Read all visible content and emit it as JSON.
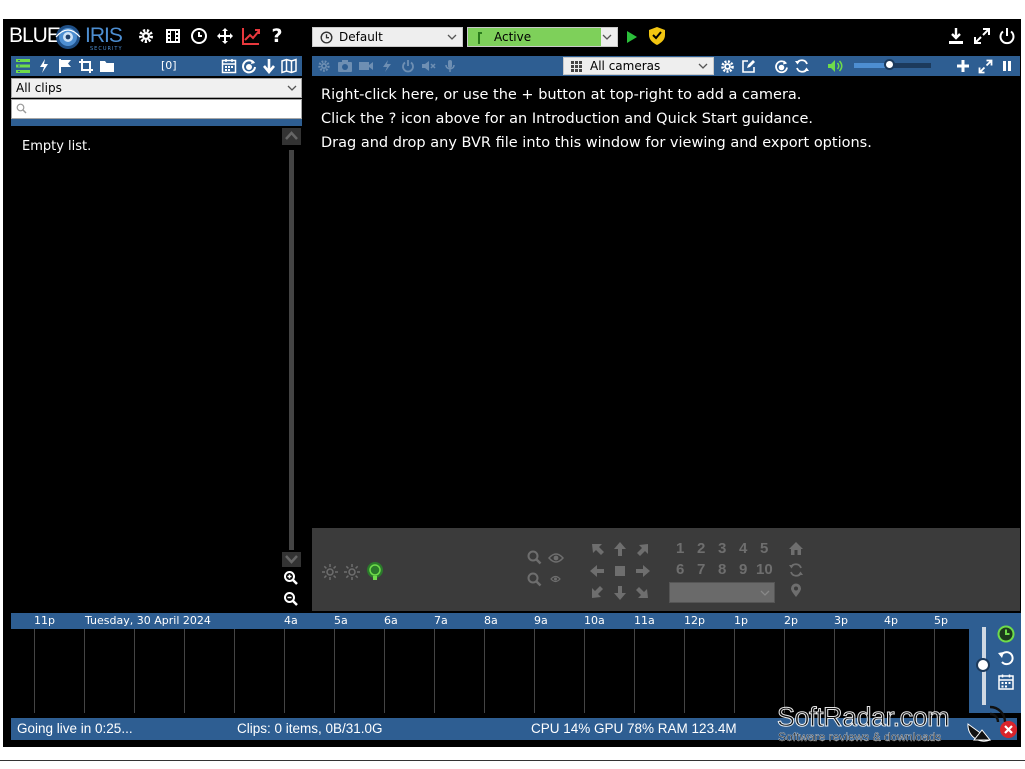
{
  "app": {
    "logo_left": "BLUE",
    "logo_right": "IRIS",
    "logo_sub": "SECURITY"
  },
  "toolbar": {
    "profile_value": "Default",
    "schedule_value": "Active",
    "icons": [
      "gear-icon",
      "clapboard-icon",
      "clock-icon",
      "move-icon",
      "chart-icon",
      "help-icon",
      "play-icon",
      "shield-icon",
      "download-icon",
      "fullscreen-icon",
      "power-icon"
    ]
  },
  "clips": {
    "count_badge": "[0]",
    "filter_value": "All clips",
    "search_placeholder": "",
    "empty_text": "Empty list."
  },
  "cameras": {
    "group_value": "All cameras",
    "volume_level": 0.45,
    "messages": [
      "Right-click here, or use the + button at top-right to add a camera.",
      "Click the ? icon above for an Introduction and Quick Start guidance.",
      "Drag and drop any BVR file into this window for viewing and export options."
    ]
  },
  "ptz": {
    "presets_row1": [
      "1",
      "2",
      "3",
      "4",
      "5"
    ],
    "presets_row2": [
      "6",
      "7",
      "8",
      "9",
      "10"
    ],
    "preset_select_value": ""
  },
  "timeline": {
    "date_label": "Tuesday, 30 April 2024",
    "hours": [
      "11p",
      "4a",
      "5a",
      "6a",
      "7a",
      "8a",
      "9a",
      "10a",
      "11a",
      "12p",
      "1p",
      "2p",
      "3p",
      "4p",
      "5p"
    ]
  },
  "status": {
    "live_text": "Going live in 0:25...",
    "clips_text": "Clips: 0 items, 0B/31.0G",
    "perf_text": "CPU 14% GPU 78% RAM 123.4M"
  },
  "watermark": {
    "brand": "SoftRadar.com",
    "tagline": "Software reviews & downloads"
  },
  "colors": {
    "panel_blue": "#2e5e92",
    "active_green": "#7ed05a",
    "play_green": "#2bbf3a",
    "shield_yellow": "#f2c511",
    "chart_red": "#e8383d",
    "close_red": "#d9242b",
    "accent_blue": "#4d8ed1"
  }
}
